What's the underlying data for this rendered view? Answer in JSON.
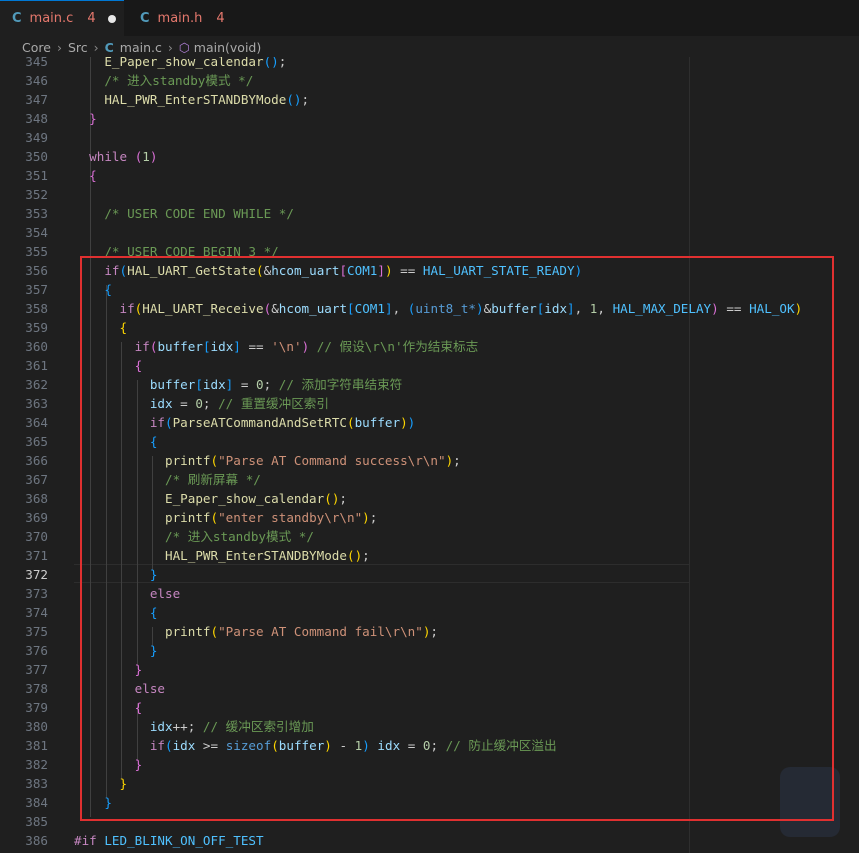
{
  "tabs": [
    {
      "icon": "C",
      "name": "main.c",
      "count": "4",
      "modified": true
    },
    {
      "icon": "C",
      "name": "main.h",
      "count": "4",
      "modified": false
    }
  ],
  "breadcrumb": [
    "Core",
    "Src",
    "main.c",
    "main(void)"
  ],
  "current_line": "372",
  "lines": [
    {
      "n": "345",
      "t": [
        [
          "    "
        ],
        [
          "E_Paper_show_calendar",
          "fn"
        ],
        [
          "()",
          "p3"
        ],
        [
          ";"
        ]
      ]
    },
    {
      "n": "346",
      "t": [
        [
          "    "
        ],
        [
          "/* 进入standby模式 */",
          "cm"
        ]
      ]
    },
    {
      "n": "347",
      "t": [
        [
          "    "
        ],
        [
          "HAL_PWR_EnterSTANDBYMode",
          "fn"
        ],
        [
          "()",
          "p3"
        ],
        [
          ";"
        ]
      ]
    },
    {
      "n": "348",
      "t": [
        [
          "  "
        ],
        [
          "}",
          "p2"
        ]
      ]
    },
    {
      "n": "349",
      "t": [
        [
          ""
        ]
      ]
    },
    {
      "n": "350",
      "t": [
        [
          "  "
        ],
        [
          "while",
          "kc"
        ],
        [
          " "
        ],
        [
          "(",
          "p2"
        ],
        [
          "1",
          "num"
        ],
        [
          ")",
          "p2"
        ]
      ]
    },
    {
      "n": "351",
      "t": [
        [
          "  "
        ],
        [
          "{",
          "p2"
        ]
      ]
    },
    {
      "n": "352",
      "t": [
        [
          ""
        ]
      ]
    },
    {
      "n": "353",
      "t": [
        [
          "    "
        ],
        [
          "/* USER CODE END WHILE */",
          "cm"
        ]
      ]
    },
    {
      "n": "354",
      "t": [
        [
          ""
        ]
      ]
    },
    {
      "n": "355",
      "t": [
        [
          "    "
        ],
        [
          "/* USER CODE BEGIN 3 */",
          "cm"
        ]
      ]
    },
    {
      "n": "356",
      "t": [
        [
          "    "
        ],
        [
          "if",
          "kc"
        ],
        [
          "(",
          "p3"
        ],
        [
          "HAL_UART_GetState",
          "fn"
        ],
        [
          "(",
          "p1"
        ],
        [
          "&"
        ],
        [
          "hcom_uart",
          "var"
        ],
        [
          "[",
          "p2"
        ],
        [
          "COM1",
          "mac"
        ],
        [
          "]",
          "p2"
        ],
        [
          ")",
          "p1"
        ],
        [
          " == "
        ],
        [
          "HAL_UART_STATE_READY",
          "mac"
        ],
        [
          ")",
          "p3"
        ]
      ]
    },
    {
      "n": "357",
      "t": [
        [
          "    "
        ],
        [
          "{",
          "p3"
        ]
      ]
    },
    {
      "n": "358",
      "t": [
        [
          "      "
        ],
        [
          "if",
          "kc"
        ],
        [
          "(",
          "p1"
        ],
        [
          "HAL_UART_Receive",
          "fn"
        ],
        [
          "(",
          "p2"
        ],
        [
          "&"
        ],
        [
          "hcom_uart",
          "var"
        ],
        [
          "[",
          "p3"
        ],
        [
          "COM1",
          "mac"
        ],
        [
          "]",
          "p3"
        ],
        [
          ", "
        ],
        [
          "(",
          "p3"
        ],
        [
          "uint8_t",
          "kw"
        ],
        [
          "*",
          "kw"
        ],
        [
          ")",
          "p3"
        ],
        [
          "&"
        ],
        [
          "buffer",
          "var"
        ],
        [
          "[",
          "p3"
        ],
        [
          "idx",
          "var"
        ],
        [
          "]",
          "p3"
        ],
        [
          ", "
        ],
        [
          "1",
          "num"
        ],
        [
          ", "
        ],
        [
          "HAL_MAX_DELAY",
          "mac"
        ],
        [
          ")",
          "p2"
        ],
        [
          " == "
        ],
        [
          "HAL_OK",
          "mac"
        ],
        [
          ")",
          "p1"
        ]
      ]
    },
    {
      "n": "359",
      "t": [
        [
          "      "
        ],
        [
          "{",
          "p1"
        ]
      ]
    },
    {
      "n": "360",
      "t": [
        [
          "        "
        ],
        [
          "if",
          "kc"
        ],
        [
          "(",
          "p2"
        ],
        [
          "buffer",
          "var"
        ],
        [
          "[",
          "p3"
        ],
        [
          "idx",
          "var"
        ],
        [
          "]",
          "p3"
        ],
        [
          " == "
        ],
        [
          "'\\n'",
          "str"
        ],
        [
          ")",
          "p2"
        ],
        [
          " "
        ],
        [
          "// 假设\\r\\n'作为结束标志",
          "cm"
        ]
      ]
    },
    {
      "n": "361",
      "t": [
        [
          "        "
        ],
        [
          "{",
          "p2"
        ]
      ]
    },
    {
      "n": "362",
      "t": [
        [
          "          "
        ],
        [
          "buffer",
          "var"
        ],
        [
          "[",
          "p3"
        ],
        [
          "idx",
          "var"
        ],
        [
          "]",
          "p3"
        ],
        [
          " = "
        ],
        [
          "0",
          "num"
        ],
        [
          "; "
        ],
        [
          "// 添加字符串结束符",
          "cm"
        ]
      ]
    },
    {
      "n": "363",
      "t": [
        [
          "          "
        ],
        [
          "idx",
          "var"
        ],
        [
          " = "
        ],
        [
          "0",
          "num"
        ],
        [
          "; "
        ],
        [
          "// 重置缓冲区索引",
          "cm"
        ]
      ]
    },
    {
      "n": "364",
      "t": [
        [
          "          "
        ],
        [
          "if",
          "kc"
        ],
        [
          "(",
          "p3"
        ],
        [
          "ParseATCommandAndSetRTC",
          "fn"
        ],
        [
          "(",
          "p1"
        ],
        [
          "buffer",
          "var"
        ],
        [
          ")",
          "p1"
        ],
        [
          ")",
          "p3"
        ]
      ]
    },
    {
      "n": "365",
      "t": [
        [
          "          "
        ],
        [
          "{",
          "p3"
        ]
      ]
    },
    {
      "n": "366",
      "t": [
        [
          "            "
        ],
        [
          "printf",
          "fn"
        ],
        [
          "(",
          "p1"
        ],
        [
          "\"Parse AT Command success\\r\\n\"",
          "str"
        ],
        [
          ")",
          "p1"
        ],
        [
          ";"
        ]
      ]
    },
    {
      "n": "367",
      "t": [
        [
          "            "
        ],
        [
          "/* 刷新屏幕 */",
          "cm"
        ]
      ]
    },
    {
      "n": "368",
      "t": [
        [
          "            "
        ],
        [
          "E_Paper_show_calendar",
          "fn"
        ],
        [
          "()",
          "p1"
        ],
        [
          ";"
        ]
      ]
    },
    {
      "n": "369",
      "t": [
        [
          "            "
        ],
        [
          "printf",
          "fn"
        ],
        [
          "(",
          "p1"
        ],
        [
          "\"enter standby\\r\\n\"",
          "str"
        ],
        [
          ")",
          "p1"
        ],
        [
          ";"
        ]
      ]
    },
    {
      "n": "370",
      "t": [
        [
          "            "
        ],
        [
          "/* 进入standby模式 */",
          "cm"
        ]
      ]
    },
    {
      "n": "371",
      "t": [
        [
          "            "
        ],
        [
          "HAL_PWR_EnterSTANDBYMode",
          "fn"
        ],
        [
          "()",
          "p1"
        ],
        [
          ";"
        ]
      ]
    },
    {
      "n": "372",
      "t": [
        [
          "          "
        ],
        [
          "}",
          "p3"
        ]
      ]
    },
    {
      "n": "373",
      "t": [
        [
          "          "
        ],
        [
          "else",
          "kc"
        ]
      ]
    },
    {
      "n": "374",
      "t": [
        [
          "          "
        ],
        [
          "{",
          "p3"
        ]
      ]
    },
    {
      "n": "375",
      "t": [
        [
          "            "
        ],
        [
          "printf",
          "fn"
        ],
        [
          "(",
          "p1"
        ],
        [
          "\"Parse AT Command fail\\r\\n\"",
          "str"
        ],
        [
          ")",
          "p1"
        ],
        [
          ";"
        ]
      ]
    },
    {
      "n": "376",
      "t": [
        [
          "          "
        ],
        [
          "}",
          "p3"
        ]
      ]
    },
    {
      "n": "377",
      "t": [
        [
          "        "
        ],
        [
          "}",
          "p2"
        ]
      ]
    },
    {
      "n": "378",
      "t": [
        [
          "        "
        ],
        [
          "else",
          "kc"
        ]
      ]
    },
    {
      "n": "379",
      "t": [
        [
          "        "
        ],
        [
          "{",
          "p2"
        ]
      ]
    },
    {
      "n": "380",
      "t": [
        [
          "          "
        ],
        [
          "idx",
          "var"
        ],
        [
          "++; "
        ],
        [
          "// 缓冲区索引增加",
          "cm"
        ]
      ]
    },
    {
      "n": "381",
      "t": [
        [
          "          "
        ],
        [
          "if",
          "kc"
        ],
        [
          "(",
          "p3"
        ],
        [
          "idx",
          "var"
        ],
        [
          " >= "
        ],
        [
          "sizeof",
          "kw"
        ],
        [
          "(",
          "p1"
        ],
        [
          "buffer",
          "var"
        ],
        [
          ")",
          "p1"
        ],
        [
          " - "
        ],
        [
          "1",
          "num"
        ],
        [
          ")",
          "p3"
        ],
        [
          " "
        ],
        [
          "idx",
          "var"
        ],
        [
          " = "
        ],
        [
          "0",
          "num"
        ],
        [
          "; "
        ],
        [
          "// 防止缓冲区溢出",
          "cm"
        ]
      ]
    },
    {
      "n": "382",
      "t": [
        [
          "        "
        ],
        [
          "}",
          "p2"
        ]
      ]
    },
    {
      "n": "383",
      "t": [
        [
          "      "
        ],
        [
          "}",
          "p1"
        ]
      ]
    },
    {
      "n": "384",
      "t": [
        [
          "    "
        ],
        [
          "}",
          "p3"
        ]
      ]
    },
    {
      "n": "385",
      "t": [
        [
          ""
        ]
      ]
    },
    {
      "n": "386",
      "t": [
        [
          "#if",
          "kc"
        ],
        [
          " "
        ],
        [
          "LED_BLINK_ON_OFF_TEST",
          "mac"
        ]
      ]
    }
  ]
}
